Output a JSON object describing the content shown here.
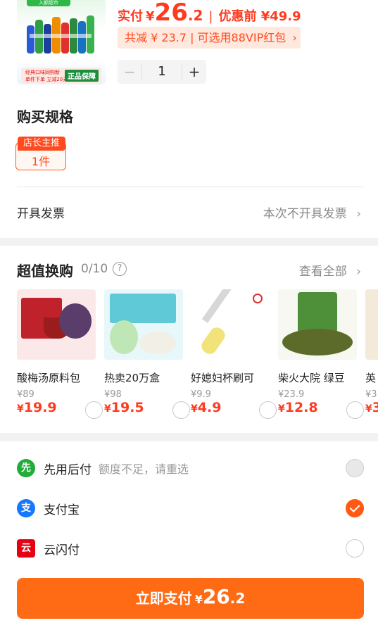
{
  "product": {
    "image_ribbon": "入额超市",
    "image_strip_line1": "经典口味同购新",
    "image_strip_line2": "单件下单 立减20元",
    "image_badge": "正品保障",
    "price_label": "实付",
    "currency": "¥",
    "price_integer": "26",
    "price_decimal": ".2",
    "separator": "|",
    "original_price": "优惠前 ¥49.9",
    "discount_text": "共减 ¥ 23.7 | 可选用88VIP红包",
    "quantity": "1",
    "minus_symbol": "−",
    "plus_symbol": "+"
  },
  "spec": {
    "title": "购买规格",
    "tag": "店长主推",
    "option": "1件"
  },
  "invoice": {
    "label": "开具发票",
    "value": "本次不开具发票"
  },
  "exchange": {
    "title": "超值换购",
    "count": "0/10",
    "help_symbol": "?",
    "view_all": "查看全部",
    "items": [
      {
        "name": "酸梅汤原料包",
        "orig": "¥89",
        "cur": "¥",
        "price": "19.9"
      },
      {
        "name": "热卖20万盒",
        "orig": "¥98",
        "cur": "¥",
        "price": "19.5"
      },
      {
        "name": "好媳妇杯刷可",
        "orig": "¥9.9",
        "cur": "¥",
        "price": "4.9"
      },
      {
        "name": "柴火大院 绿豆",
        "orig": "¥23.9",
        "cur": "¥",
        "price": "12.8"
      },
      {
        "name": "英",
        "orig": "¥3",
        "cur": "¥",
        "price": "3"
      }
    ]
  },
  "payment": {
    "options": [
      {
        "label": "先用后付",
        "note": "额度不足，请重选",
        "icon_char": "先"
      },
      {
        "label": "支付宝",
        "note": "",
        "icon_char": "支"
      },
      {
        "label": "云闪付",
        "note": "",
        "icon_char": "云"
      }
    ],
    "button_text": "立即支付",
    "button_currency": "¥",
    "button_integer": "26",
    "button_decimal": ".2"
  },
  "colors": {
    "accent": "#ff6a14",
    "price_red": "#ff3b1f",
    "alipay_blue": "#1677ff",
    "green": "#22ac38",
    "unionpay_red": "#e60012"
  }
}
